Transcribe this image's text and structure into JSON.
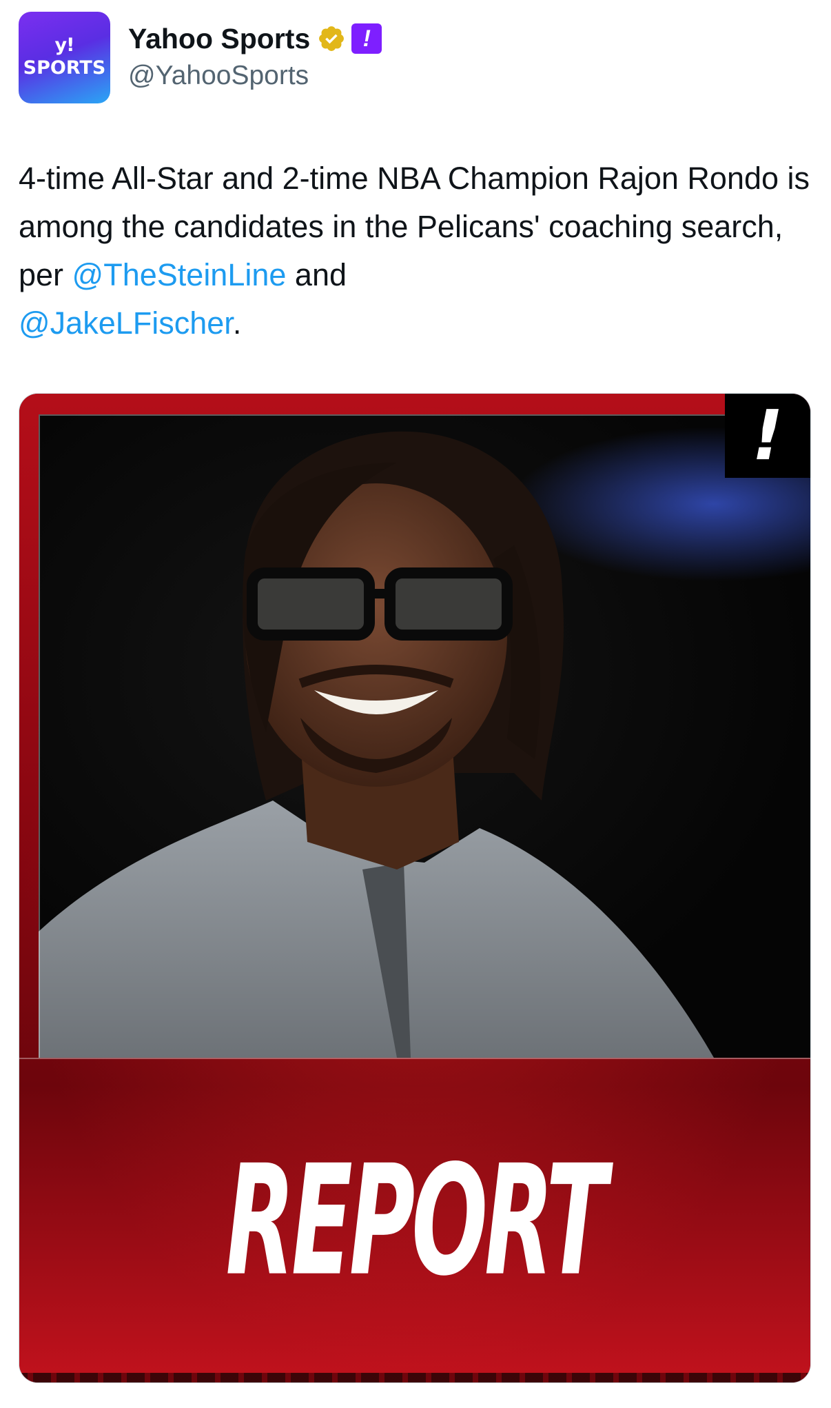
{
  "account": {
    "avatar_logo": "y!",
    "avatar_word": "SPORTS",
    "display_name": "Yahoo Sports",
    "handle": "@YahooSports",
    "affiliate_badge": "!"
  },
  "tweet": {
    "text_1": "4-time All-Star and 2-time NBA Champion Rajon Rondo is among the candidates in the Pelicans' coaching search, per ",
    "mention_1": "@TheSteinLine",
    "text_2": " and ",
    "mention_2": "@JakeLFischer",
    "text_3": "."
  },
  "media": {
    "corner_badge": "!",
    "headline": "REPORT"
  },
  "colors": {
    "link": "#1d9bf0",
    "handle": "#536471",
    "verified_gold": "#e2b719",
    "affiliate_purple": "#7e1fff",
    "media_red": "#b40e19"
  },
  "icons": {
    "verified": "verified-gold-badge-icon"
  }
}
